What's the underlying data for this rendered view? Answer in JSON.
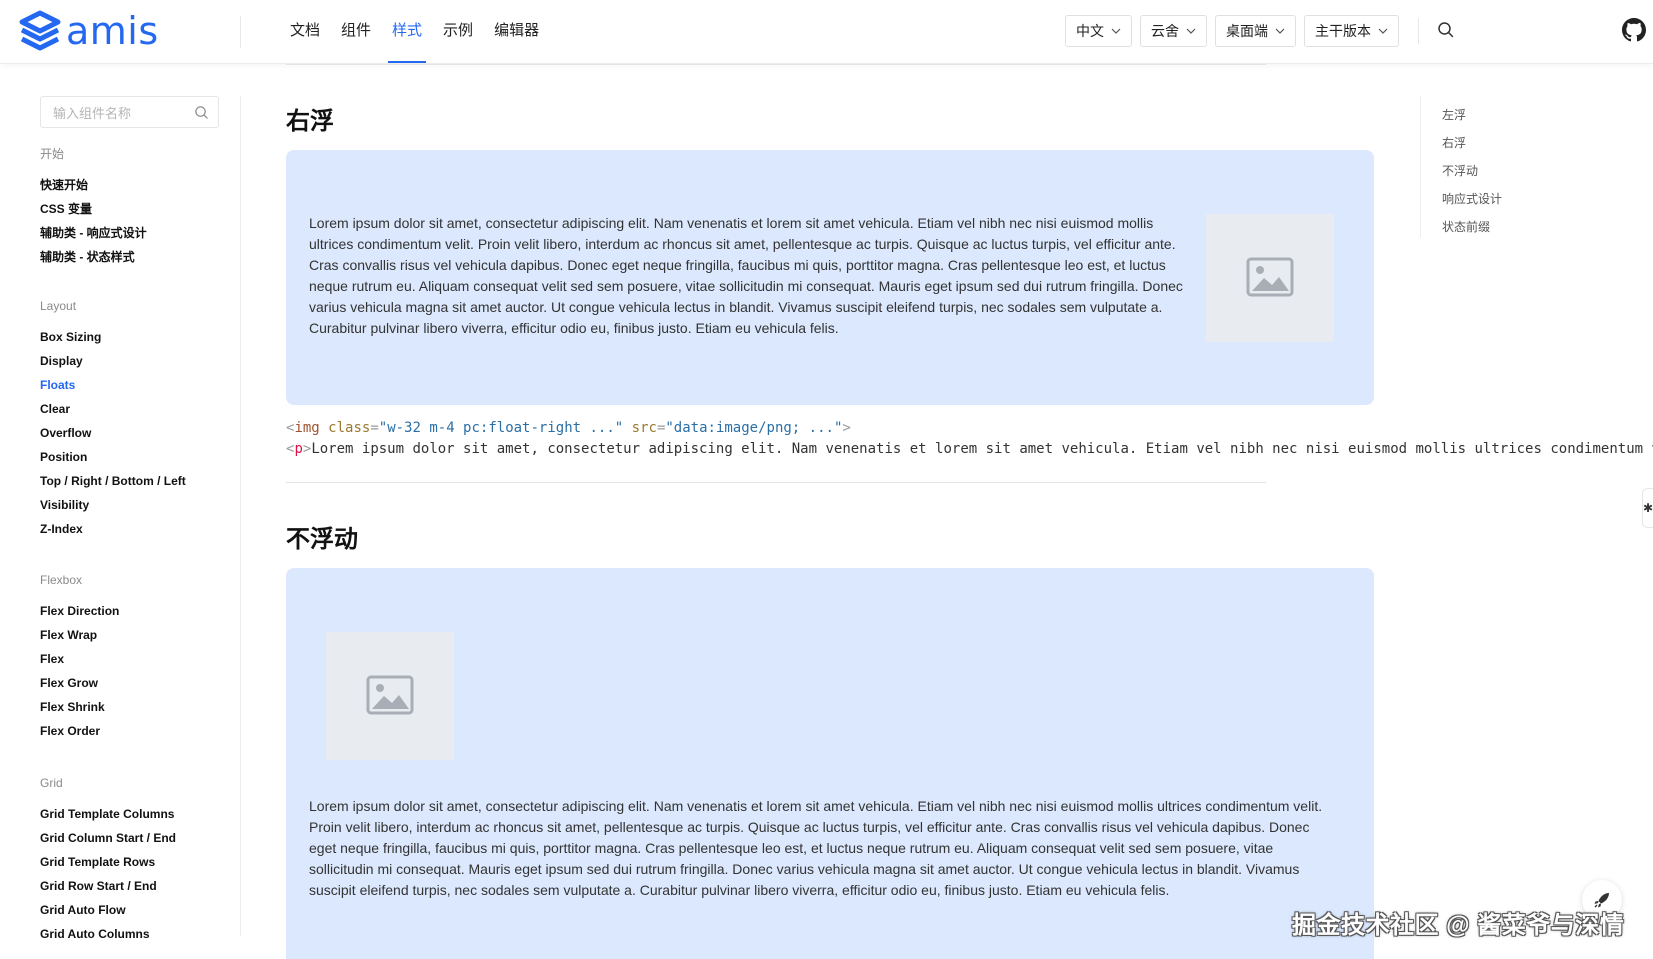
{
  "header": {
    "logo_text": "amis",
    "nav": [
      "文档",
      "组件",
      "样式",
      "示例",
      "编辑器"
    ],
    "nav_active": "样式",
    "selects": [
      "中文",
      "云舍",
      "桌面端",
      "主干版本"
    ]
  },
  "sidebar": {
    "search_placeholder": "输入组件名称",
    "groups": [
      {
        "title": "开始",
        "items": [
          "快速开始",
          "CSS 变量",
          "辅助类 - 响应式设计",
          "辅助类 - 状态样式"
        ]
      },
      {
        "title": "Layout",
        "items": [
          "Box Sizing",
          "Display",
          "Floats",
          "Clear",
          "Overflow",
          "Position",
          "Top / Right / Bottom / Left",
          "Visibility",
          "Z-Index"
        ]
      },
      {
        "title": "Flexbox",
        "items": [
          "Flex Direction",
          "Flex Wrap",
          "Flex",
          "Flex Grow",
          "Flex Shrink",
          "Flex Order"
        ]
      },
      {
        "title": "Grid",
        "items": [
          "Grid Template Columns",
          "Grid Column Start / End",
          "Grid Template Rows",
          "Grid Row Start / End",
          "Grid Auto Flow",
          "Grid Auto Columns"
        ]
      }
    ],
    "active_item": "Floats"
  },
  "toc": [
    "左浮",
    "右浮",
    "不浮动",
    "响应式设计",
    "状态前缀"
  ],
  "content": {
    "section1_title": "右浮",
    "section1_text": "Lorem ipsum dolor sit amet, consectetur adipiscing elit. Nam venenatis et lorem sit amet vehicula. Etiam vel nibh nec nisi euismod mollis ultrices condimentum velit. Proin velit libero, interdum ac rhoncus sit amet, pellentesque ac turpis. Quisque ac luctus turpis, vel efficitur ante. Cras convallis risus vel vehicula dapibus. Donec eget neque fringilla, faucibus mi quis, porttitor magna. Cras pellentesque leo est, et luctus neque rutrum eu. Aliquam consequat velit sed sem posuere, vitae sollicitudin mi consequat. Mauris eget ipsum sed dui rutrum fringilla. Donec varius vehicula magna sit amet auctor. Ut congue vehicula lectus in blandit. Vivamus suscipit eleifend turpis, nec sodales sem vulputate a. Curabitur pulvinar libero viverra, efficitur odio eu, finibus justo. Etiam eu vehicula felis.",
    "code": {
      "line1": {
        "open": "<",
        "tag": "img",
        "attr1": "class",
        "eq1": "=",
        "val1": "\"w-32 m-4 pc:float-right ...\"",
        "attr2": "src",
        "eq2": "=",
        "val2": "\"data:image/png; ...\"",
        "close": ">"
      },
      "line2": {
        "open": "<",
        "tag": "p",
        "close": ">",
        "text": "Lorem ipsum dolor sit amet, consectetur adipiscing elit. Nam venenatis et lorem sit amet vehicula. Etiam vel nibh nec nisi euismod mollis ultrices condimentum velit."
      }
    },
    "section2_title": "不浮动",
    "section2_text": "Lorem ipsum dolor sit amet, consectetur adipiscing elit. Nam venenatis et lorem sit amet vehicula. Etiam vel nibh nec nisi euismod mollis ultrices condimentum velit. Proin velit libero, interdum ac rhoncus sit amet, pellentesque ac turpis. Quisque ac luctus turpis, vel efficitur ante. Cras convallis risus vel vehicula dapibus. Donec eget neque fringilla, faucibus mi quis, porttitor magna. Cras pellentesque leo est, et luctus neque rutrum eu. Aliquam consequat velit sed sem posuere, vitae sollicitudin mi consequat. Mauris eget ipsum sed dui rutrum fringilla. Donec varius vehicula magna sit amet auctor. Ut congue vehicula lectus in blandit. Vivamus suscipit eleifend turpis, nec sodales sem vulputate a. Curabitur pulvinar libero viverra, efficitur odio eu, finibus justo. Etiam eu vehicula felis."
  },
  "watermark": "掘金技术社区 @ 酱菜爷与深情",
  "icons": {
    "logo": "amis-logo-icon",
    "search": "search-icon",
    "chevron": "chevron-down-icon",
    "github": "github-icon",
    "image_placeholder": "image-placeholder-icon",
    "rocket": "rocket-icon"
  },
  "colors": {
    "accent": "#2468f2",
    "demo_bg": "#dbe8fd",
    "placeholder_bg": "#e8ebf0"
  }
}
